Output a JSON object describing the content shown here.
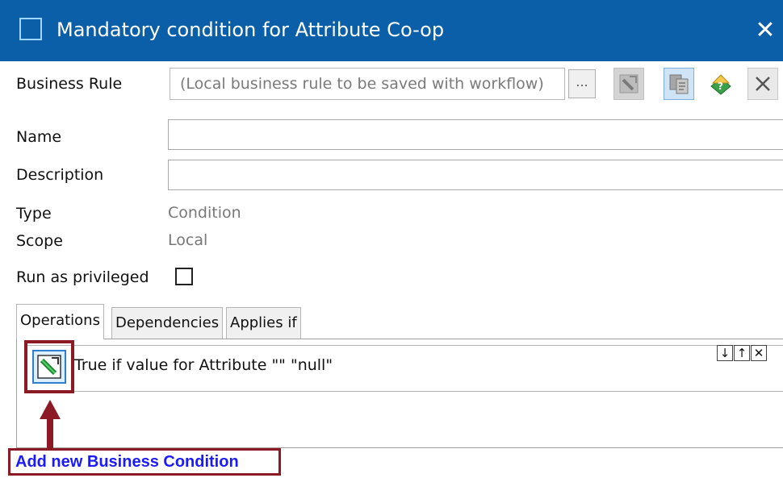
{
  "dialog": {
    "title": "Mandatory condition for Attribute Co-op",
    "close_glyph": "✕"
  },
  "form": {
    "business_rule_label": "Business Rule",
    "business_rule_value": "(Local business rule to be saved with workflow)",
    "browse_label": "...",
    "name_label": "Name",
    "name_value": "",
    "description_label": "Description",
    "description_value": "",
    "type_label": "Type",
    "type_value": "Condition",
    "scope_label": "Scope",
    "scope_value": "Local",
    "privileged_label": "Run as privileged",
    "privileged_checked": false
  },
  "toolbar": {
    "icons": [
      "edit-rule-icon",
      "copy-rule-icon",
      "help-rule-icon",
      "remove-rule-icon"
    ]
  },
  "tabs": [
    {
      "label": "Operations",
      "active": true
    },
    {
      "label": "Dependencies",
      "active": false
    },
    {
      "label": "Applies if",
      "active": false
    }
  ],
  "operations": {
    "row_text": "True if value for Attribute \"\"  \"null\"",
    "controls": [
      "↓",
      "↑",
      "✕"
    ]
  },
  "annotation": {
    "callout_text": "Add new Business Condition",
    "color": "#8b1a24"
  },
  "colors": {
    "titlebar": "#0a5fa8",
    "link": "#1a1aff"
  }
}
